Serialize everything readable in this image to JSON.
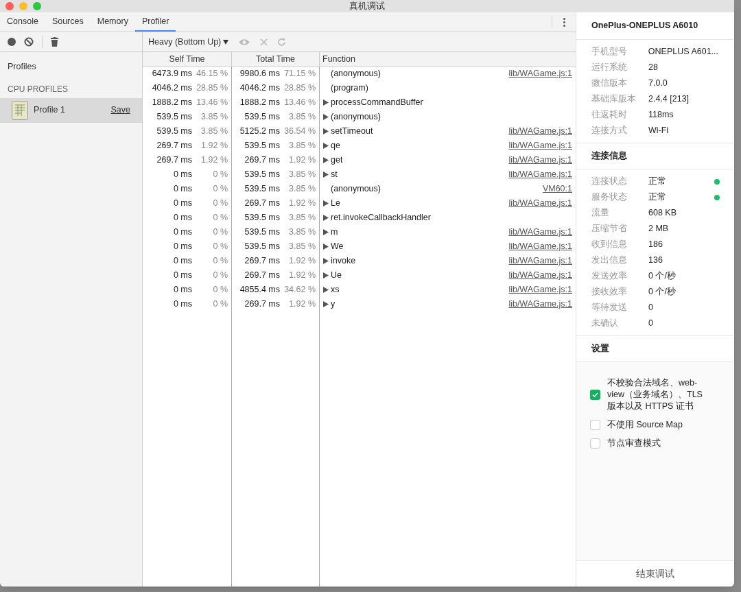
{
  "window": {
    "title": "真机调试"
  },
  "tabs": [
    {
      "label": "Console",
      "selected": false
    },
    {
      "label": "Sources",
      "selected": false
    },
    {
      "label": "Memory",
      "selected": false
    },
    {
      "label": "Profiler",
      "selected": true
    }
  ],
  "view_select": {
    "value": "Heavy (Bottom Up)"
  },
  "sidebar": {
    "title": "Profiles",
    "section": "CPU PROFILES",
    "items": [
      {
        "label": "Profile 1",
        "action": "Save",
        "selected": true
      }
    ]
  },
  "table": {
    "columns": [
      "Self Time",
      "Total Time",
      "Function"
    ],
    "rows": [
      {
        "self": "6473.9 ms",
        "self_pct": "46.15 %",
        "total": "9980.6 ms",
        "total_pct": "71.15 %",
        "function": "(anonymous)",
        "expandable": false,
        "url": "lib/WAGame.js:1"
      },
      {
        "self": "4046.2 ms",
        "self_pct": "28.85 %",
        "total": "4046.2 ms",
        "total_pct": "28.85 %",
        "function": "(program)",
        "expandable": false
      },
      {
        "self": "1888.2 ms",
        "self_pct": "13.46 %",
        "total": "1888.2 ms",
        "total_pct": "13.46 %",
        "function": "processCommandBuffer",
        "expandable": true
      },
      {
        "self": "539.5 ms",
        "self_pct": "3.85 %",
        "total": "539.5 ms",
        "total_pct": "3.85 %",
        "function": "(anonymous)",
        "expandable": true
      },
      {
        "self": "539.5 ms",
        "self_pct": "3.85 %",
        "total": "5125.2 ms",
        "total_pct": "36.54 %",
        "function": "setTimeout",
        "expandable": true,
        "url": "lib/WAGame.js:1"
      },
      {
        "self": "269.7 ms",
        "self_pct": "1.92 %",
        "total": "539.5 ms",
        "total_pct": "3.85 %",
        "function": "qe",
        "expandable": true,
        "url": "lib/WAGame.js:1"
      },
      {
        "self": "269.7 ms",
        "self_pct": "1.92 %",
        "total": "269.7 ms",
        "total_pct": "1.92 %",
        "function": "get",
        "expandable": true,
        "url": "lib/WAGame.js:1"
      },
      {
        "self": "0 ms",
        "self_pct": "0 %",
        "total": "539.5 ms",
        "total_pct": "3.85 %",
        "function": "st",
        "expandable": true,
        "url": "lib/WAGame.js:1"
      },
      {
        "self": "0 ms",
        "self_pct": "0 %",
        "total": "539.5 ms",
        "total_pct": "3.85 %",
        "function": "(anonymous)",
        "expandable": false,
        "url": "VM60:1"
      },
      {
        "self": "0 ms",
        "self_pct": "0 %",
        "total": "269.7 ms",
        "total_pct": "1.92 %",
        "function": "Le",
        "expandable": true,
        "url": "lib/WAGame.js:1"
      },
      {
        "self": "0 ms",
        "self_pct": "0 %",
        "total": "539.5 ms",
        "total_pct": "3.85 %",
        "function": "ret.invokeCallbackHandler",
        "expandable": true
      },
      {
        "self": "0 ms",
        "self_pct": "0 %",
        "total": "539.5 ms",
        "total_pct": "3.85 %",
        "function": "m",
        "expandable": true,
        "url": "lib/WAGame.js:1"
      },
      {
        "self": "0 ms",
        "self_pct": "0 %",
        "total": "539.5 ms",
        "total_pct": "3.85 %",
        "function": "We",
        "expandable": true,
        "url": "lib/WAGame.js:1"
      },
      {
        "self": "0 ms",
        "self_pct": "0 %",
        "total": "269.7 ms",
        "total_pct": "1.92 %",
        "function": "invoke",
        "expandable": true,
        "url": "lib/WAGame.js:1"
      },
      {
        "self": "0 ms",
        "self_pct": "0 %",
        "total": "269.7 ms",
        "total_pct": "1.92 %",
        "function": "Ue",
        "expandable": true,
        "url": "lib/WAGame.js:1"
      },
      {
        "self": "0 ms",
        "self_pct": "0 %",
        "total": "4855.4 ms",
        "total_pct": "34.62 %",
        "function": "xs",
        "expandable": true,
        "url": "lib/WAGame.js:1"
      },
      {
        "self": "0 ms",
        "self_pct": "0 %",
        "total": "269.7 ms",
        "total_pct": "1.92 %",
        "function": "y",
        "expandable": true,
        "url": "lib/WAGame.js:1"
      }
    ]
  },
  "device_panel": {
    "title": "OnePlus-ONEPLUS A6010",
    "info": [
      {
        "label": "手机型号",
        "value": "ONEPLUS A601..."
      },
      {
        "label": "运行系统",
        "value": "28"
      },
      {
        "label": "微信版本",
        "value": "7.0.0"
      },
      {
        "label": "基础库版本",
        "value": "2.4.4 [213]"
      },
      {
        "label": "往返耗时",
        "value": "118ms"
      },
      {
        "label": "连接方式",
        "value": "Wi-Fi"
      }
    ],
    "connection_title": "连接信息",
    "connection": [
      {
        "label": "连接状态",
        "value": "正常",
        "color": "#19c06a"
      },
      {
        "label": "服务状态",
        "value": "正常",
        "color": "#19c06a"
      },
      {
        "label": "流量",
        "value": "608 KB"
      },
      {
        "label": "压缩节省",
        "value": "2 MB"
      },
      {
        "label": "收到信息",
        "value": "186"
      },
      {
        "label": "发出信息",
        "value": "136"
      },
      {
        "label": "发送效率",
        "value": "0 个/秒"
      },
      {
        "label": "接收效率",
        "value": "0 个/秒"
      },
      {
        "label": "等待发送",
        "value": "0"
      },
      {
        "label": "未确认",
        "value": "0"
      }
    ],
    "settings_title": "设置",
    "settings": [
      {
        "label": "不校验合法域名、web-view（业务域名）、TLS 版本以及 HTTPS 证书",
        "checked": true
      },
      {
        "label": "不使用 Source Map",
        "checked": false
      },
      {
        "label": "节点审查模式",
        "checked": false
      }
    ],
    "end_button": "结束调试"
  }
}
